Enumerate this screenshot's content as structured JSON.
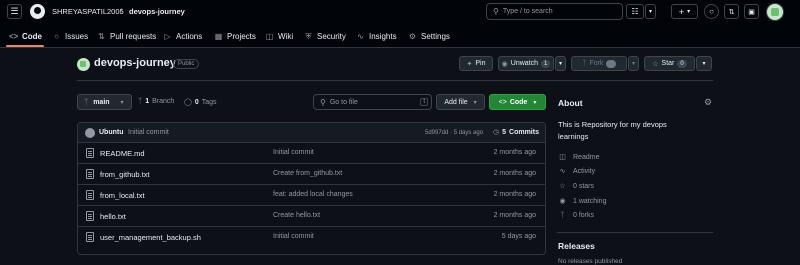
{
  "header": {
    "owner": "SHREYASPATIL2005",
    "separator": "/",
    "repo": "devops-journey",
    "search_placeholder": "Type / to search",
    "search_key": "/"
  },
  "nav_tabs": [
    {
      "label": "Code",
      "icon": "code-icon"
    },
    {
      "label": "Issues",
      "icon": "issue-icon"
    },
    {
      "label": "Pull requests",
      "icon": "pull-request-icon"
    },
    {
      "label": "Actions",
      "icon": "play-icon"
    },
    {
      "label": "Projects",
      "icon": "table-icon"
    },
    {
      "label": "Wiki",
      "icon": "book-icon"
    },
    {
      "label": "Security",
      "icon": "shield-icon"
    },
    {
      "label": "Insights",
      "icon": "graph-icon"
    },
    {
      "label": "Settings",
      "icon": "gear-icon"
    }
  ],
  "repo_header": {
    "name": "devops-journey",
    "visibility": "Public",
    "pin_label": "Pin",
    "unwatch_label": "Unwatch",
    "unwatch_count": "1",
    "fork_label": "Fork",
    "fork_count": "0",
    "star_label": "Star",
    "star_count": "0"
  },
  "toolbar": {
    "branch": "main",
    "branch_count": "1",
    "branch_label": "Branch",
    "tag_count": "0",
    "tag_label": "Tags",
    "goto_placeholder": "Go to file",
    "goto_key": "t",
    "add_file_label": "Add file",
    "code_label": "Code"
  },
  "commit": {
    "author": "Ubuntu",
    "message": "Initial commit",
    "hash_time": "5d997dd · 5 days ago",
    "commits_count": "5",
    "commits_label": "Commits"
  },
  "files": [
    {
      "name": "README.md",
      "message": "Initial commit",
      "date": "2 months ago"
    },
    {
      "name": "from_github.txt",
      "message": "Create from_github.txt",
      "date": "2 months ago"
    },
    {
      "name": "from_local.txt",
      "message": "feat: added local changes",
      "date": "2 months ago"
    },
    {
      "name": "hello.txt",
      "message": "Create hello.txt",
      "date": "2 months ago"
    },
    {
      "name": "user_management_backup.sh",
      "message": "Initial commit",
      "date": "5 days ago"
    }
  ],
  "about": {
    "title": "About",
    "description": "This is Repository for my devops learnings",
    "items": [
      {
        "icon": "book-icon",
        "label": "Readme"
      },
      {
        "icon": "pulse-icon",
        "label": "Activity"
      },
      {
        "icon": "star-icon",
        "label": "0 stars"
      },
      {
        "icon": "eye-icon",
        "label": "1 watching"
      },
      {
        "icon": "fork-icon",
        "label": "0 forks"
      }
    ]
  },
  "releases": {
    "title": "Releases",
    "partial": "No releases published"
  },
  "colors": {
    "accent_green": "#238636",
    "tab_underline": "#f78166",
    "bg": "#0d1117"
  }
}
